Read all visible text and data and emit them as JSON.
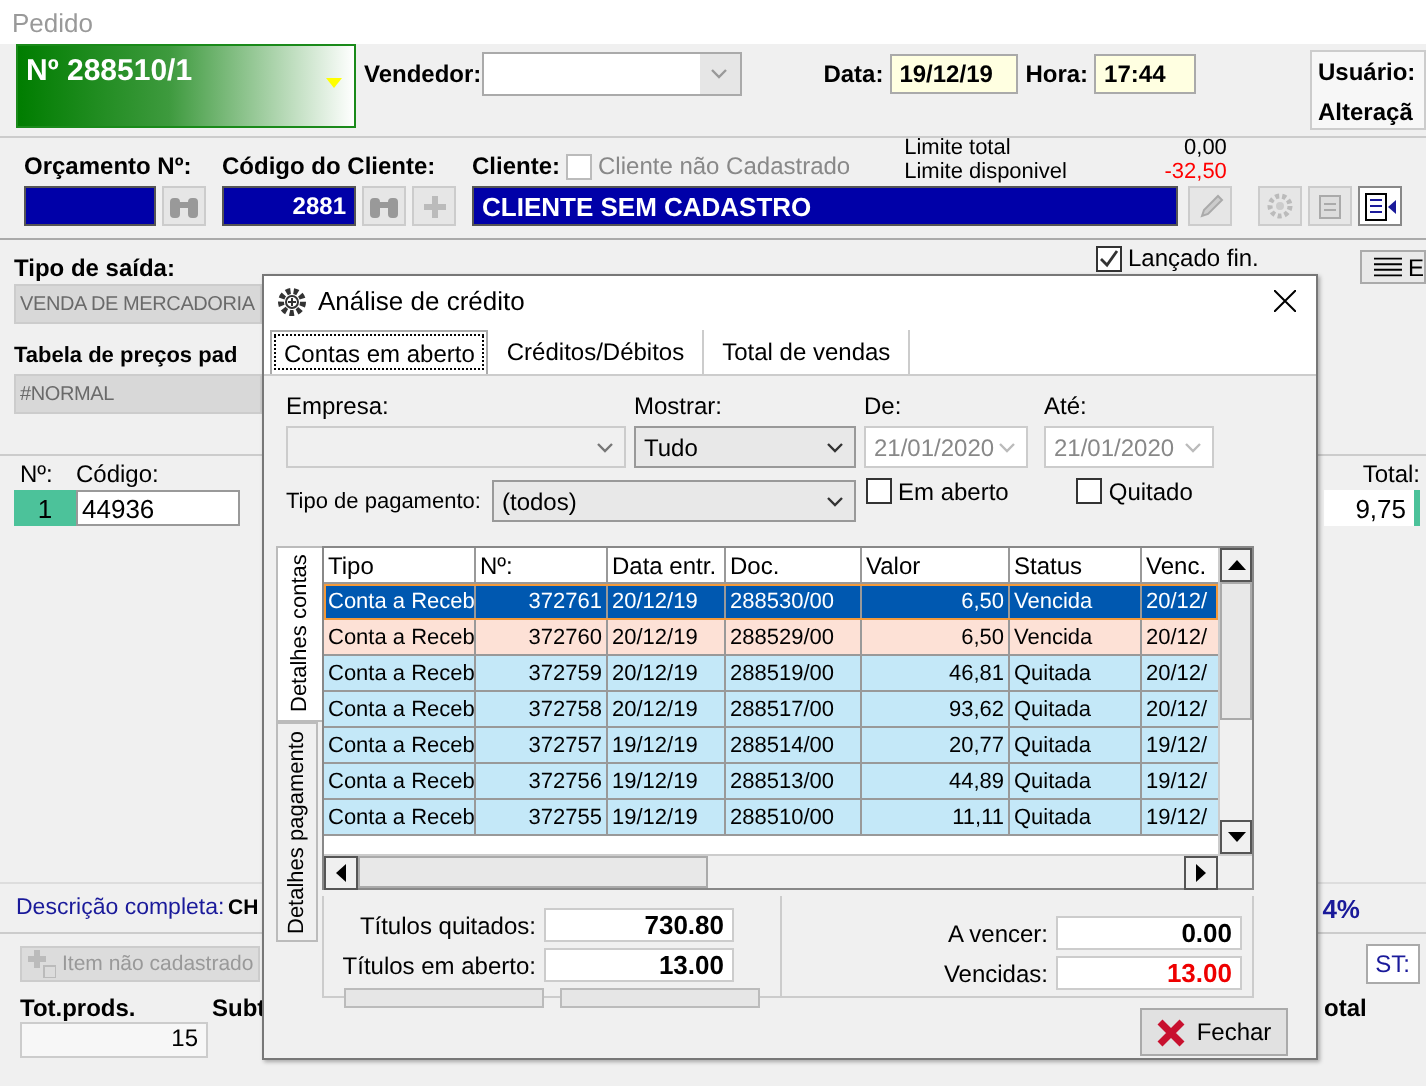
{
  "window": {
    "title": "Pedido"
  },
  "header": {
    "order_number": "Nº 288510/1",
    "seller_label": "Vendedor:",
    "date_label": "Data:",
    "date": "19/12/19",
    "time_label": "Hora:",
    "time": "17:44",
    "user_label": "Usuário:",
    "user_value": "Alteraçã"
  },
  "client": {
    "budget_label": "Orçamento Nº:",
    "code_label": "Código do Cliente:",
    "code": "2881",
    "client_label": "Cliente:",
    "unregistered": {
      "label": "Cliente não Cadastrado",
      "checked": false,
      "disabled": true
    },
    "limit_total_label": "Limite total",
    "limit_total": "0,00",
    "limit_available_label": "Limite disponivel",
    "limit_available": "-32,50",
    "client_name": "CLIENTE SEM CADASTRO"
  },
  "launched": {
    "label": "Lançado fin.",
    "checked": true
  },
  "side_button": "E",
  "exit_type": {
    "label": "Tipo de saída:",
    "value": "VENDA DE MERCADORIA"
  },
  "price_table": {
    "label": "Tabela de preços pad",
    "value": "#NORMAL"
  },
  "items": {
    "columns": [
      "Nº:",
      "Código:",
      "Total:"
    ],
    "rows": [
      {
        "number": "1",
        "code": "44936",
        "total": "9,75"
      }
    ]
  },
  "description": {
    "label": "Descrição completa:",
    "value": "CH",
    "discount": "4%"
  },
  "item_button": {
    "label": "Item não cadastrado",
    "disabled": true
  },
  "st_button": "ST:",
  "totals": {
    "columns": [
      "Tot.prods.",
      "Subt",
      "otal"
    ],
    "products": "15"
  },
  "dialog": {
    "title": "Análise de crédito",
    "tabs": [
      {
        "label": "Contas em aberto",
        "selected": true
      },
      {
        "label": "Créditos/Débitos",
        "selected": false
      },
      {
        "label": "Total de vendas",
        "selected": false
      }
    ],
    "filters": {
      "company_label": "Empresa:",
      "show_label": "Mostrar:",
      "show": "Tudo",
      "from_label": "De:",
      "from": "21/01/2020",
      "to_label": "Até:",
      "to": "21/01/2020",
      "payment_label": "Tipo de pagamento:",
      "payment": "(todos)",
      "open": {
        "label": "Em aberto",
        "checked": false
      },
      "paid": {
        "label": "Quitado",
        "checked": false
      }
    },
    "side_tabs": [
      {
        "label": "Detalhes contas",
        "selected": true
      },
      {
        "label": "Detalhes pagamento",
        "selected": false
      }
    ],
    "table": {
      "columns": [
        "Tipo",
        "Nº:",
        "Data entr.",
        "Doc.",
        "Valor",
        "Status",
        "Venc."
      ],
      "rows": [
        {
          "cells": [
            "Conta a Receb",
            "372761",
            "20/12/19",
            "288530/00",
            "6,50",
            "Vencida",
            "20/12/"
          ],
          "selected": true,
          "color": "#0058b0"
        },
        {
          "cells": [
            "Conta a Receb",
            "372760",
            "20/12/19",
            "288529/00",
            "6,50",
            "Vencida",
            "20/12/"
          ],
          "selected": false,
          "color": "#fde1d6"
        },
        {
          "cells": [
            "Conta a Receb",
            "372759",
            "20/12/19",
            "288519/00",
            "46,81",
            "Quitada",
            "20/12/"
          ],
          "selected": false,
          "color": "#c4e8f8"
        },
        {
          "cells": [
            "Conta a Receb",
            "372758",
            "20/12/19",
            "288517/00",
            "93,62",
            "Quitada",
            "20/12/"
          ],
          "selected": false,
          "color": "#c4e8f8"
        },
        {
          "cells": [
            "Conta a Receb",
            "372757",
            "19/12/19",
            "288514/00",
            "20,77",
            "Quitada",
            "19/12/"
          ],
          "selected": false,
          "color": "#c4e8f8"
        },
        {
          "cells": [
            "Conta a Receb",
            "372756",
            "19/12/19",
            "288513/00",
            "44,89",
            "Quitada",
            "19/12/"
          ],
          "selected": false,
          "color": "#c4e8f8"
        },
        {
          "cells": [
            "Conta a Receb",
            "372755",
            "19/12/19",
            "288510/00",
            "11,11",
            "Quitada",
            "19/12/"
          ],
          "selected": false,
          "color": "#c4e8f8"
        }
      ]
    },
    "summary": {
      "paid_label": "Títulos quitados:",
      "paid": "730.80",
      "open_label": "Títulos em aberto:",
      "open": "13.00",
      "due_label": "A vencer:",
      "due": "0.00",
      "overdue_label": "Vencidas:",
      "overdue": "13.00"
    },
    "close_button": "Fechar"
  }
}
